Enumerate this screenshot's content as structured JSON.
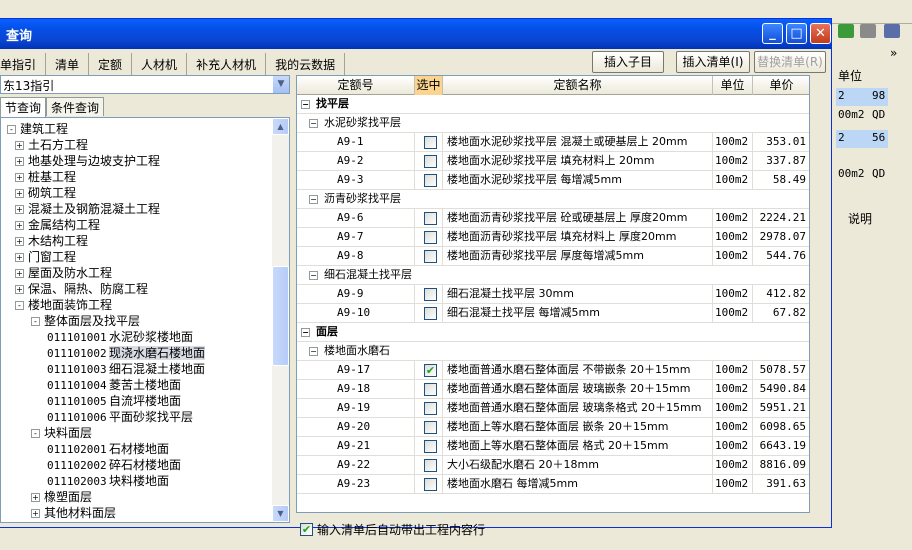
{
  "title": "查询",
  "window_buttons": {
    "minimize": "_",
    "maximize": "□",
    "close": "✕"
  },
  "tabs": [
    "单指引",
    "清单",
    "定额",
    "人材机",
    "补充人材机",
    "我的云数据"
  ],
  "actions": {
    "insert_child": "插入子目",
    "insert_list": "插入清单(I)",
    "replace_list": "替换清单(R)"
  },
  "combo_value": "东13指引",
  "left_tabs": [
    "节查询",
    "条件查询"
  ],
  "tree": [
    {
      "label": "建筑工程",
      "pm": "-",
      "level": 0
    },
    {
      "label": "土石方工程",
      "pm": "+",
      "level": 1
    },
    {
      "label": "地基处理与边坡支护工程",
      "pm": "+",
      "level": 1
    },
    {
      "label": "桩基工程",
      "pm": "+",
      "level": 1
    },
    {
      "label": "砌筑工程",
      "pm": "+",
      "level": 1
    },
    {
      "label": "混凝土及钢筋混凝土工程",
      "pm": "+",
      "level": 1
    },
    {
      "label": "金属结构工程",
      "pm": "+",
      "level": 1
    },
    {
      "label": "木结构工程",
      "pm": "+",
      "level": 1
    },
    {
      "label": "门窗工程",
      "pm": "+",
      "level": 1
    },
    {
      "label": "屋面及防水工程",
      "pm": "+",
      "level": 1
    },
    {
      "label": "保温、隔热、防腐工程",
      "pm": "+",
      "level": 1
    },
    {
      "label": "楼地面装饰工程",
      "pm": "-",
      "level": 1
    },
    {
      "label": "整体面层及找平层",
      "pm": "-",
      "level": 2
    },
    {
      "code": "011101001",
      "label": "水泥砂浆楼地面",
      "level": 3
    },
    {
      "code": "011101002",
      "label": "现浇水磨石楼地面",
      "level": 3,
      "selected": true
    },
    {
      "code": "011101003",
      "label": "细石混凝土楼地面",
      "level": 3
    },
    {
      "code": "011101004",
      "label": "菱苦土楼地面",
      "level": 3
    },
    {
      "code": "011101005",
      "label": "自流坪楼地面",
      "level": 3
    },
    {
      "code": "011101006",
      "label": "平面砂浆找平层",
      "level": 3
    },
    {
      "label": "块料面层",
      "pm": "-",
      "level": 2
    },
    {
      "code": "011102001",
      "label": "石材楼地面",
      "level": 3
    },
    {
      "code": "011102002",
      "label": "碎石材楼地面",
      "level": 3
    },
    {
      "code": "011102003",
      "label": "块料楼地面",
      "level": 3
    },
    {
      "label": "橡塑面层",
      "pm": "+",
      "level": 2
    },
    {
      "label": "其他材料面层",
      "pm": "+",
      "level": 2
    }
  ],
  "grid_headers": {
    "code": "定额号",
    "selected": "选中",
    "name": "定额名称",
    "unit": "单位",
    "price": "单价"
  },
  "grid_rows": [
    {
      "type": "group",
      "label": "找平层"
    },
    {
      "type": "sub",
      "label": "水泥砂浆找平层"
    },
    {
      "type": "item",
      "code": "A9-1",
      "checked": false,
      "name": "楼地面水泥砂浆找平层 混凝土或硬基层上 20mm",
      "unit": "100m2",
      "price": "353.01"
    },
    {
      "type": "item",
      "code": "A9-2",
      "checked": false,
      "name": "楼地面水泥砂浆找平层 填充材料上 20mm",
      "unit": "100m2",
      "price": "337.87"
    },
    {
      "type": "item",
      "code": "A9-3",
      "checked": false,
      "name": "楼地面水泥砂浆找平层 每增减5mm",
      "unit": "100m2",
      "price": "58.49"
    },
    {
      "type": "sub",
      "label": "沥青砂浆找平层"
    },
    {
      "type": "item",
      "code": "A9-6",
      "checked": false,
      "name": "楼地面沥青砂浆找平层 砼或硬基层上 厚度20mm",
      "unit": "100m2",
      "price": "2224.21"
    },
    {
      "type": "item",
      "code": "A9-7",
      "checked": false,
      "name": "楼地面沥青砂浆找平层 填充材料上 厚度20mm",
      "unit": "100m2",
      "price": "2978.07"
    },
    {
      "type": "item",
      "code": "A9-8",
      "checked": false,
      "name": "楼地面沥青砂浆找平层 厚度每增减5mm",
      "unit": "100m2",
      "price": "544.76"
    },
    {
      "type": "sub",
      "label": "细石混凝土找平层"
    },
    {
      "type": "item",
      "code": "A9-9",
      "checked": false,
      "name": "细石混凝土找平层 30mm",
      "unit": "100m2",
      "price": "412.82"
    },
    {
      "type": "item",
      "code": "A9-10",
      "checked": false,
      "name": "细石混凝土找平层 每增减5mm",
      "unit": "100m2",
      "price": "67.82"
    },
    {
      "type": "group",
      "label": "面层"
    },
    {
      "type": "sub",
      "label": "楼地面水磨石"
    },
    {
      "type": "item",
      "code": "A9-17",
      "checked": true,
      "name": "楼地面普通水磨石整体面层 不带嵌条 20＋15mm",
      "unit": "100m2",
      "price": "5078.57"
    },
    {
      "type": "item",
      "code": "A9-18",
      "checked": false,
      "name": "楼地面普通水磨石整体面层 玻璃嵌条 20＋15mm",
      "unit": "100m2",
      "price": "5490.84"
    },
    {
      "type": "item",
      "code": "A9-19",
      "checked": false,
      "name": "楼地面普通水磨石整体面层 玻璃条格式 20＋15mm",
      "unit": "100m2",
      "price": "5951.21"
    },
    {
      "type": "item",
      "code": "A9-20",
      "checked": false,
      "name": "楼地面上等水磨石整体面层 嵌条 20＋15mm",
      "unit": "100m2",
      "price": "6098.65"
    },
    {
      "type": "item",
      "code": "A9-21",
      "checked": false,
      "name": "楼地面上等水磨石整体面层 格式 20＋15mm",
      "unit": "100m2",
      "price": "6643.19"
    },
    {
      "type": "item",
      "code": "A9-22",
      "checked": false,
      "name": "大小石级配水磨石 20＋18mm",
      "unit": "100m2",
      "price": "8816.09"
    },
    {
      "type": "item",
      "code": "A9-23",
      "checked": false,
      "name": "楼地面水磨石 每增减5mm",
      "unit": "100m2",
      "price": "391.63"
    }
  ],
  "bottom_checkbox": {
    "checked": true,
    "label": "输入清单后自动带出工程内容行"
  },
  "right_panel": {
    "header": "单位",
    "cells": [
      {
        "a": "2",
        "b": "98",
        "sel": true
      },
      {
        "a": "00m2",
        "b": "QD",
        "sel": false
      },
      {
        "a": "2",
        "b": "56",
        "sel": true
      },
      {
        "a": "00m2",
        "b": "QD",
        "sel": false
      }
    ],
    "desc": "说明",
    "nav": "» "
  }
}
